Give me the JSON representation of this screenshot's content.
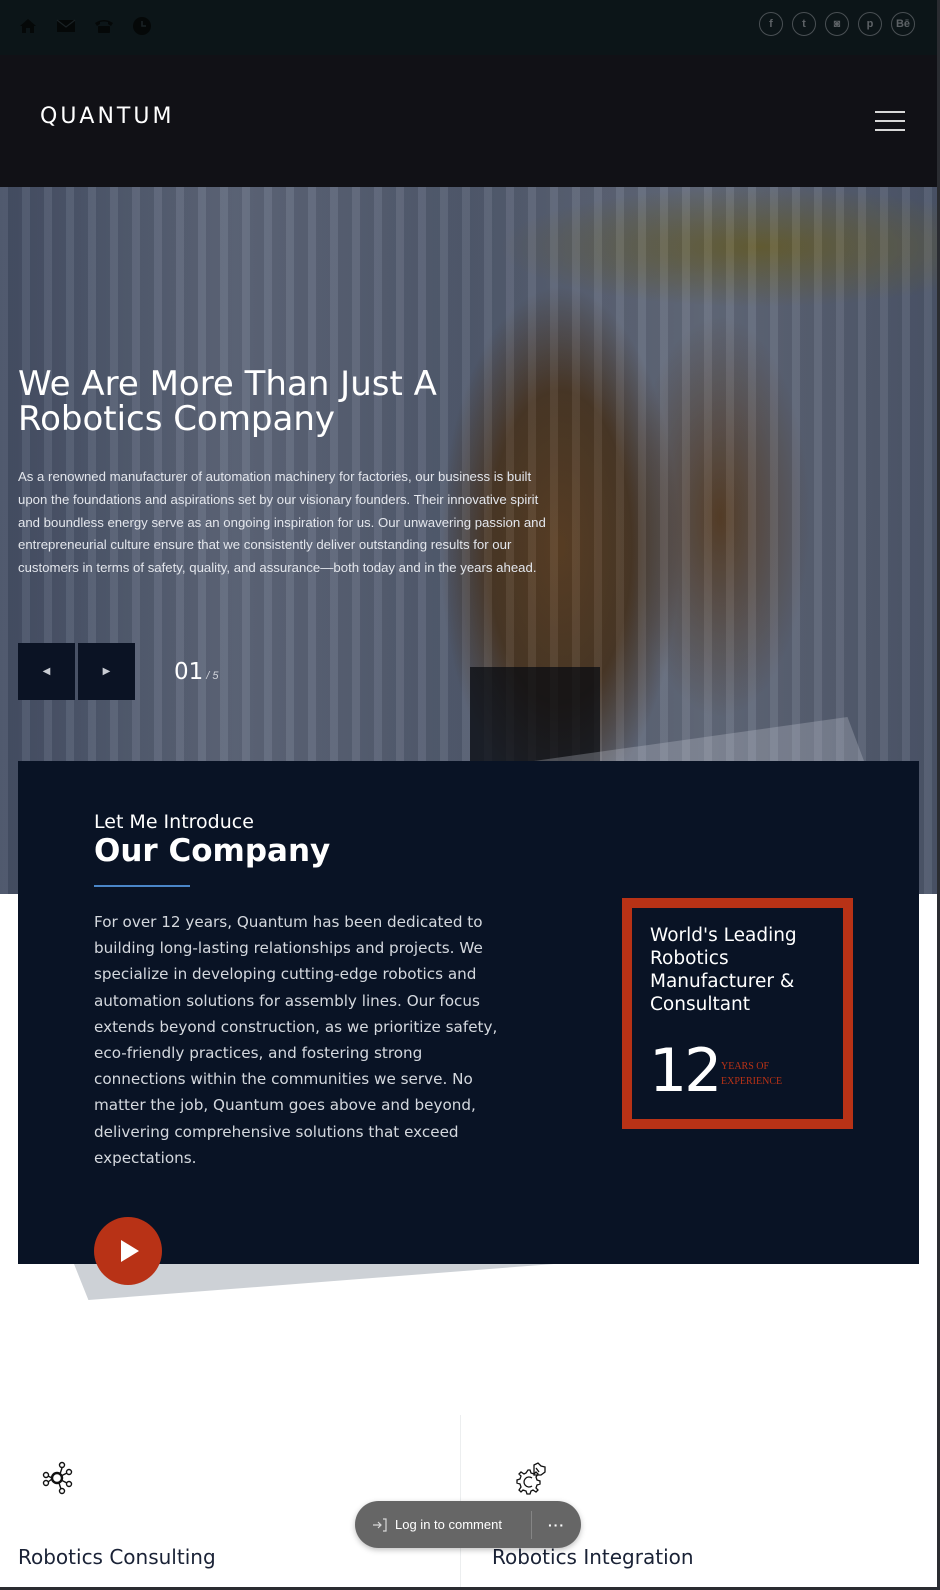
{
  "topbar": {
    "contact_icons": [
      "home-icon",
      "mail-icon",
      "phone-icon",
      "clock-icon"
    ],
    "social_links": [
      {
        "name": "facebook",
        "glyph": "f"
      },
      {
        "name": "twitter",
        "glyph": "t"
      },
      {
        "name": "instagram",
        "glyph": "◙"
      },
      {
        "name": "pinterest",
        "glyph": "p"
      },
      {
        "name": "behance",
        "glyph": "Bē"
      }
    ]
  },
  "header": {
    "logo": "QUANTUM",
    "menu_icon": "hamburger-icon"
  },
  "hero": {
    "title": "We Are More Than Just A Robotics Company",
    "text": "As a renowned manufacturer of automation machinery for factories, our business is built upon the foundations and aspirations set by our visionary founders. Their innovative spirit and boundless energy serve as an ongoing inspiration for us. Our unwavering passion and entrepreneurial culture ensure that we consistently deliver outstanding results for our customers in terms of safety, quality, and assurance—both today and in the years ahead.",
    "prev_icon": "◀",
    "next_icon": "▶",
    "slide_current": "01",
    "slide_total": "/ 5"
  },
  "intro": {
    "kicker": "Let Me Introduce",
    "title": "Our Company",
    "text": "For over 12 years, Quantum has been dedicated to building long-lasting relationships and projects. We specialize in developing cutting-edge robotics and automation solutions for assembly lines. Our focus extends beyond construction, as we prioritize safety, eco-friendly practices, and fostering strong connections within the communities we serve. No matter the job, Quantum goes above and beyond, delivering comprehensive solutions that exceed expectations.",
    "badge": {
      "title": "World's Leading Robotics Manufacturer & Consultant",
      "number": "12",
      "label_line1": "Years of",
      "label_line2": "Experience"
    },
    "accent_color": "#b83216"
  },
  "services": [
    {
      "title": "Robotics Consulting",
      "icon": "network-gear-icon"
    },
    {
      "title": "Robotics Integration",
      "icon": "gear-integration-icon"
    }
  ],
  "comment_bar": {
    "login_label": "Log in to comment",
    "more_label": "···"
  }
}
